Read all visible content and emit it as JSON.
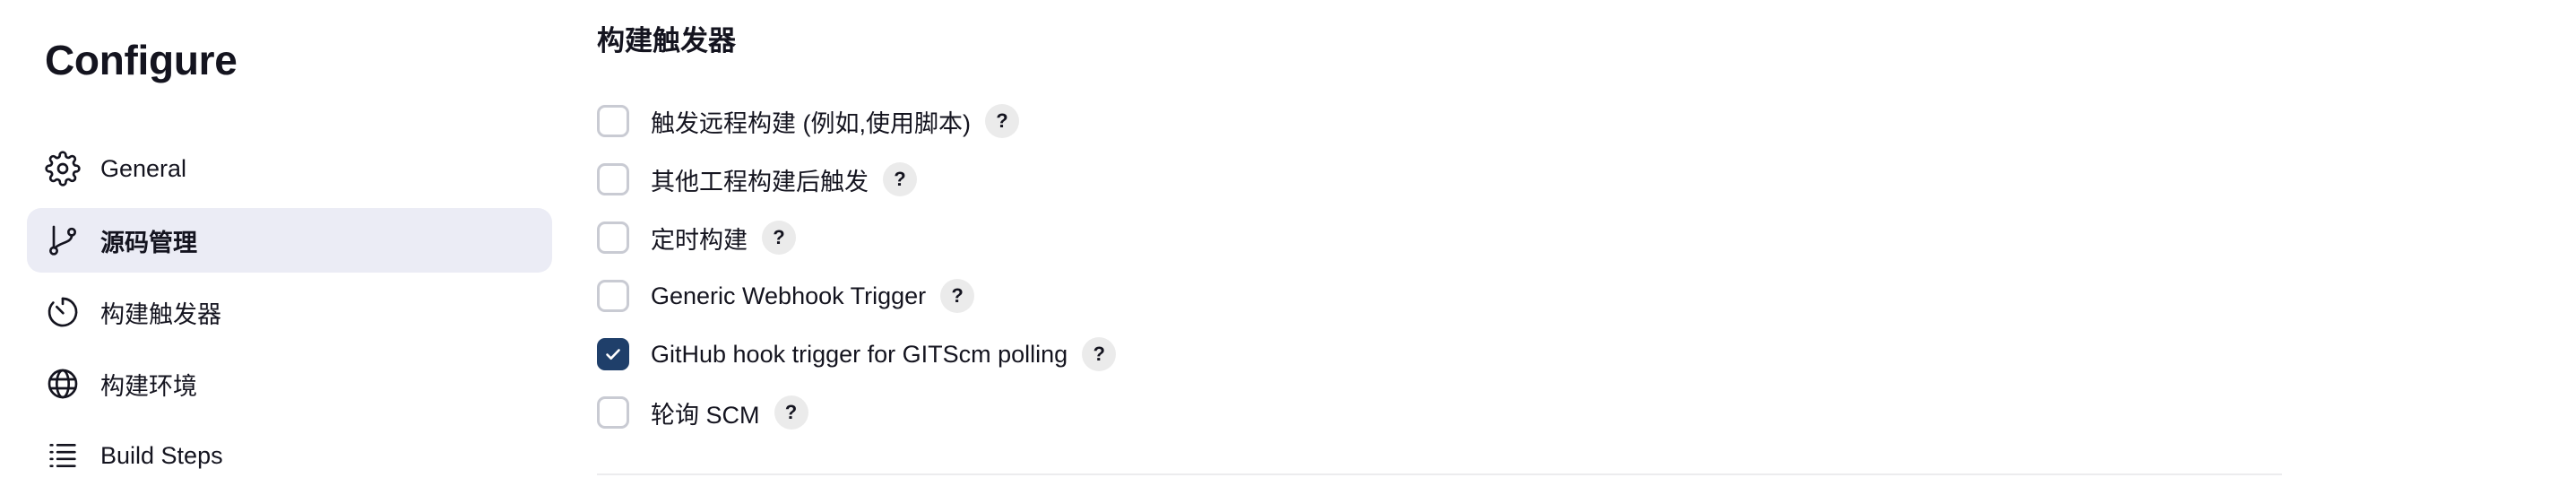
{
  "page": {
    "title": "Configure"
  },
  "sidebar": {
    "items": [
      {
        "label": "General",
        "icon": "gear-icon",
        "active": false
      },
      {
        "label": "源码管理",
        "icon": "git-branch-icon",
        "active": true
      },
      {
        "label": "构建触发器",
        "icon": "timer-icon",
        "active": false
      },
      {
        "label": "构建环境",
        "icon": "globe-icon",
        "active": false
      },
      {
        "label": "Build Steps",
        "icon": "list-icon",
        "active": false
      }
    ]
  },
  "main": {
    "section_title": "构建触发器",
    "help_label": "?",
    "options": [
      {
        "label": "触发远程构建 (例如,使用脚本)",
        "checked": false
      },
      {
        "label": "其他工程构建后触发",
        "checked": false
      },
      {
        "label": "定时构建",
        "checked": false
      },
      {
        "label": "Generic Webhook Trigger",
        "checked": false
      },
      {
        "label": "GitHub hook trigger for GITScm polling",
        "checked": true
      },
      {
        "label": "轮询 SCM",
        "checked": false
      }
    ]
  },
  "colors": {
    "accent": "#1f3f6a",
    "active_nav_bg": "#ebecf5",
    "text": "#14141f",
    "checkbox_border": "#c9cbd3",
    "help_bg": "#ebebeb"
  }
}
